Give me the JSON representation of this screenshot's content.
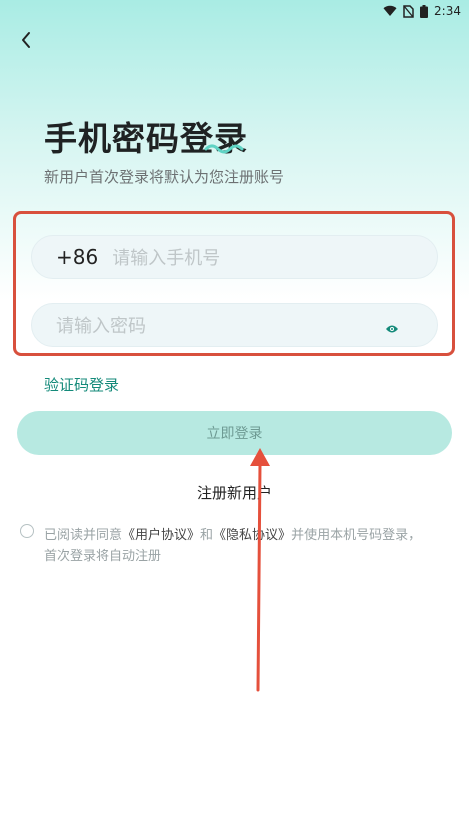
{
  "status_bar": {
    "time": "2:34"
  },
  "header": {
    "title": "手机密码登录",
    "subtitle": "新用户首次登录将默认为您注册账号"
  },
  "form": {
    "country_code": "+86",
    "phone_placeholder": "请输入手机号",
    "password_placeholder": "请输入密码"
  },
  "links": {
    "code_login": "验证码登录",
    "register": "注册新用户"
  },
  "login_button": {
    "label": "立即登录"
  },
  "agreement": {
    "prefix": "已阅读并同意",
    "user_agreement": "《用户协议》",
    "and": "和",
    "privacy_agreement": "《隐私协议》",
    "suffix": "并使用本机号码登录，首次登录将自动注册"
  },
  "colors": {
    "accent": "#148a7a",
    "button_bg": "#b7e9e1",
    "highlight_border": "#d8503d",
    "arrow": "#e5503c"
  }
}
